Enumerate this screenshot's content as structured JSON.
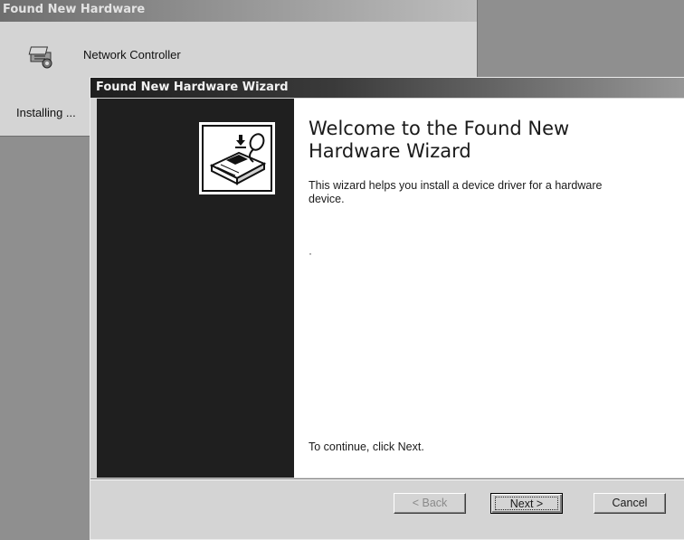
{
  "background_window": {
    "title": "Found New Hardware",
    "device_name": "Network Controller",
    "status": "Installing ..."
  },
  "wizard": {
    "title": "Found New Hardware Wizard",
    "heading": "Welcome to the Found New Hardware Wizard",
    "description": "This wizard helps you install a device driver for a hardware device.",
    "continue_text": "To continue, click Next.",
    "buttons": {
      "back": "< Back",
      "next": "Next >",
      "cancel": "Cancel"
    }
  },
  "icons": {
    "device": "network-hardware-icon",
    "wizard_logo": "hardware-wizard-icon"
  }
}
